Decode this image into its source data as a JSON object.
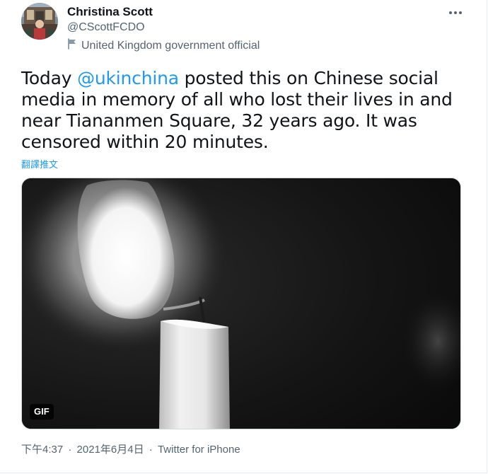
{
  "author": {
    "display_name": "Christina Scott",
    "handle": "@CScottFCDO",
    "label": "United Kingdom government official"
  },
  "tweet": {
    "text_before": "Today ",
    "mention": "@ukinchina",
    "text_after": " posted this on Chinese social media in memory of all who lost their lives in and near Tiananmen Square, 32 years ago. It was censored within 20 minutes.",
    "translate_label": "翻譯推文"
  },
  "media": {
    "badge": "GIF"
  },
  "meta": {
    "time": "下午4:37",
    "separator": "·",
    "date": "2021年6月4日",
    "source": "Twitter for iPhone"
  },
  "colors": {
    "accent": "#1d9bf0",
    "secondary_text": "#536471",
    "primary_text": "#0f1419"
  },
  "icons": {
    "more": "more-horizontal-icon",
    "label_flag": "flag-icon"
  }
}
